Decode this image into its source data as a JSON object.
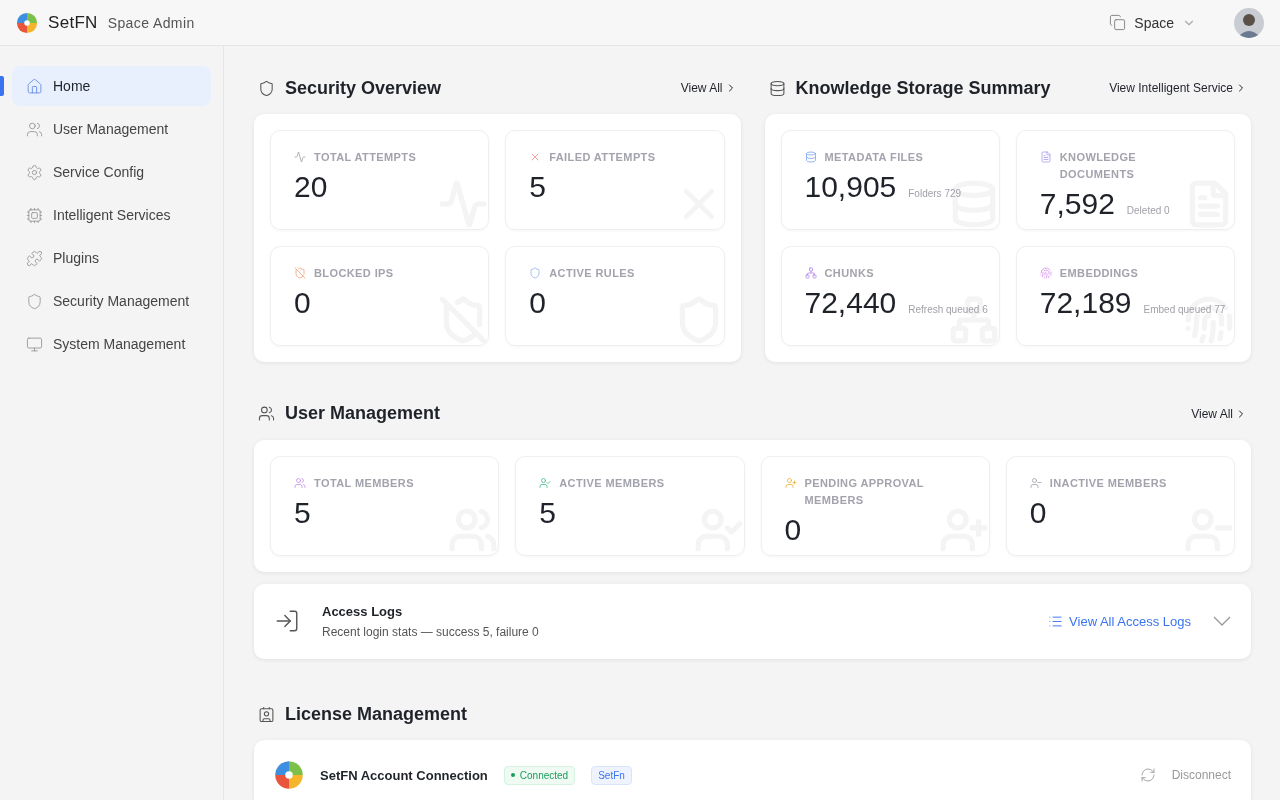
{
  "header": {
    "brand": "SetFN",
    "subtitle": "Space Admin",
    "space": "Space"
  },
  "sidebar": {
    "items": [
      {
        "label": "Home",
        "selected": true
      },
      {
        "label": "User Management",
        "selected": false
      },
      {
        "label": "Service Config",
        "selected": false
      },
      {
        "label": "Intelligent Services",
        "selected": false
      },
      {
        "label": "Plugins",
        "selected": false
      },
      {
        "label": "Security Management",
        "selected": false
      },
      {
        "label": "System Management",
        "selected": false
      }
    ]
  },
  "security_overview": {
    "title": "Security Overview",
    "link": "View All",
    "stats": [
      {
        "label": "TOTAL ATTEMPTS",
        "value": "20"
      },
      {
        "label": "FAILED ATTEMPTS",
        "value": "5"
      },
      {
        "label": "BLOCKED IPS",
        "value": "0"
      },
      {
        "label": "ACTIVE RULES",
        "value": "0"
      }
    ]
  },
  "knowledge_storage": {
    "title": "Knowledge Storage Summary",
    "link": "View Intelligent Service",
    "stats": [
      {
        "label": "METADATA FILES",
        "value": "10,905",
        "note": "Folders 729"
      },
      {
        "label": "KNOWLEDGE DOCUMENTS",
        "value": "7,592",
        "note": "Deleted 0"
      },
      {
        "label": "CHUNKS",
        "value": "72,440",
        "note": "Refresh queued 6"
      },
      {
        "label": "EMBEDDINGS",
        "value": "72,189",
        "note": "Embed queued 77"
      }
    ]
  },
  "user_management": {
    "title": "User Management",
    "link": "View All",
    "stats": [
      {
        "label": "TOTAL MEMBERS",
        "value": "5"
      },
      {
        "label": "ACTIVE MEMBERS",
        "value": "5"
      },
      {
        "label": "PENDING APPROVAL MEMBERS",
        "value": "0"
      },
      {
        "label": "INACTIVE MEMBERS",
        "value": "0"
      }
    ]
  },
  "access_logs": {
    "title": "Access Logs",
    "summary": "Recent login stats — success 5, failure 0",
    "link": "View All Access Logs",
    "expanded": false
  },
  "license_management": {
    "title": "License Management",
    "connection": {
      "name": "SetFN Account Connection",
      "status": "Connected",
      "provider": "SetFn",
      "action": "Disconnect"
    }
  }
}
